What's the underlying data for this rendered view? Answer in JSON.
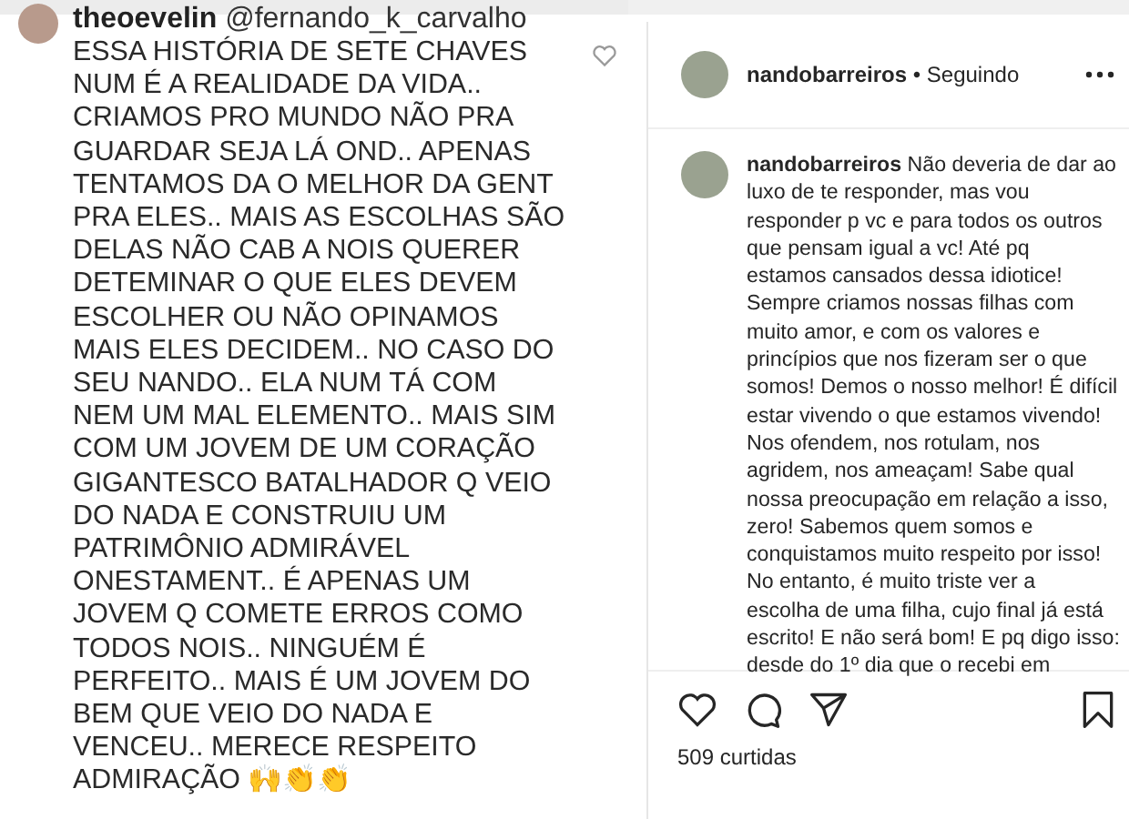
{
  "left_comment": {
    "username": "theoevelin",
    "mention": "@fernando_k_carvalho",
    "lines": [
      "ESSA HISTÓRIA DE SETE CHAVES",
      "NUM É A REALIDADE DA VIDA..",
      "CRIAMOS PRO MUNDO NÃO PRA",
      "GUARDAR SEJA LÁ OND.. APENAS",
      "TENTAMOS DA O MELHOR DA GENT",
      "PRA ELES.. MAIS AS ESCOLHAS SÃO",
      "DELAS NÃO CAB A NOIS QUERER",
      "DETEMINAR O QUE ELES DEVEM",
      "ESCOLHER OU NÃO OPINAMOS",
      "MAIS ELES DECIDEM.. NO CASO DO",
      "SEU NANDO.. ELA NUM TÁ COM",
      "NEM UM MAL ELEMENTO.. MAIS SIM",
      "COM UM JOVEM DE UM CORAÇÃO",
      "GIGANTESCO BATALHADOR Q VEIO",
      "DO NADA E CONSTRUIU UM",
      "PATRIMÔNIO ADMIRÁVEL",
      "ONESTAMENT.. É  APENAS UM",
      "JOVEM Q COMETE ERROS COMO",
      "TODOS NOIS.. NINGUÉM É",
      "PERFEITO.. MAIS É UM JOVEM DO",
      "BEM QUE VEIO DO NADA E",
      "VENCEU.. MERECE RESPEITO",
      "ADMIRAÇÃO 🙌👏👏"
    ]
  },
  "post": {
    "username": "nandobarreiros",
    "follow_status": "• Seguindo",
    "caption_lines": [
      "**nandobarreiros** Não deveria de dar ao",
      "luxo de te responder, mas vou",
      "responder p vc e para todos os outros",
      "que pensam igual a vc! Até pq",
      "estamos cansados dessa idiotice!",
      "Sempre criamos nossas filhas com",
      "muito amor, e com os valores e",
      "princípios que nos fizeram ser o que",
      "somos! Demos o nosso melhor! É difícil",
      "estar vivendo o que estamos vivendo!",
      "Nos ofendem, nos rotulam, nos",
      "agridem, nos ameaçam! Sabe qual",
      "nossa preocupação em relação a isso,",
      "zero! Sabemos quem somos e",
      "conquistamos muito respeito por isso!",
      "No entanto, é muito triste ver a",
      "escolha de uma filha, cujo final já está",
      "escrito! E não será bom! E pq digo isso:",
      "desde do 1º dia que o recebi em"
    ],
    "likes": "509 curtidas"
  }
}
